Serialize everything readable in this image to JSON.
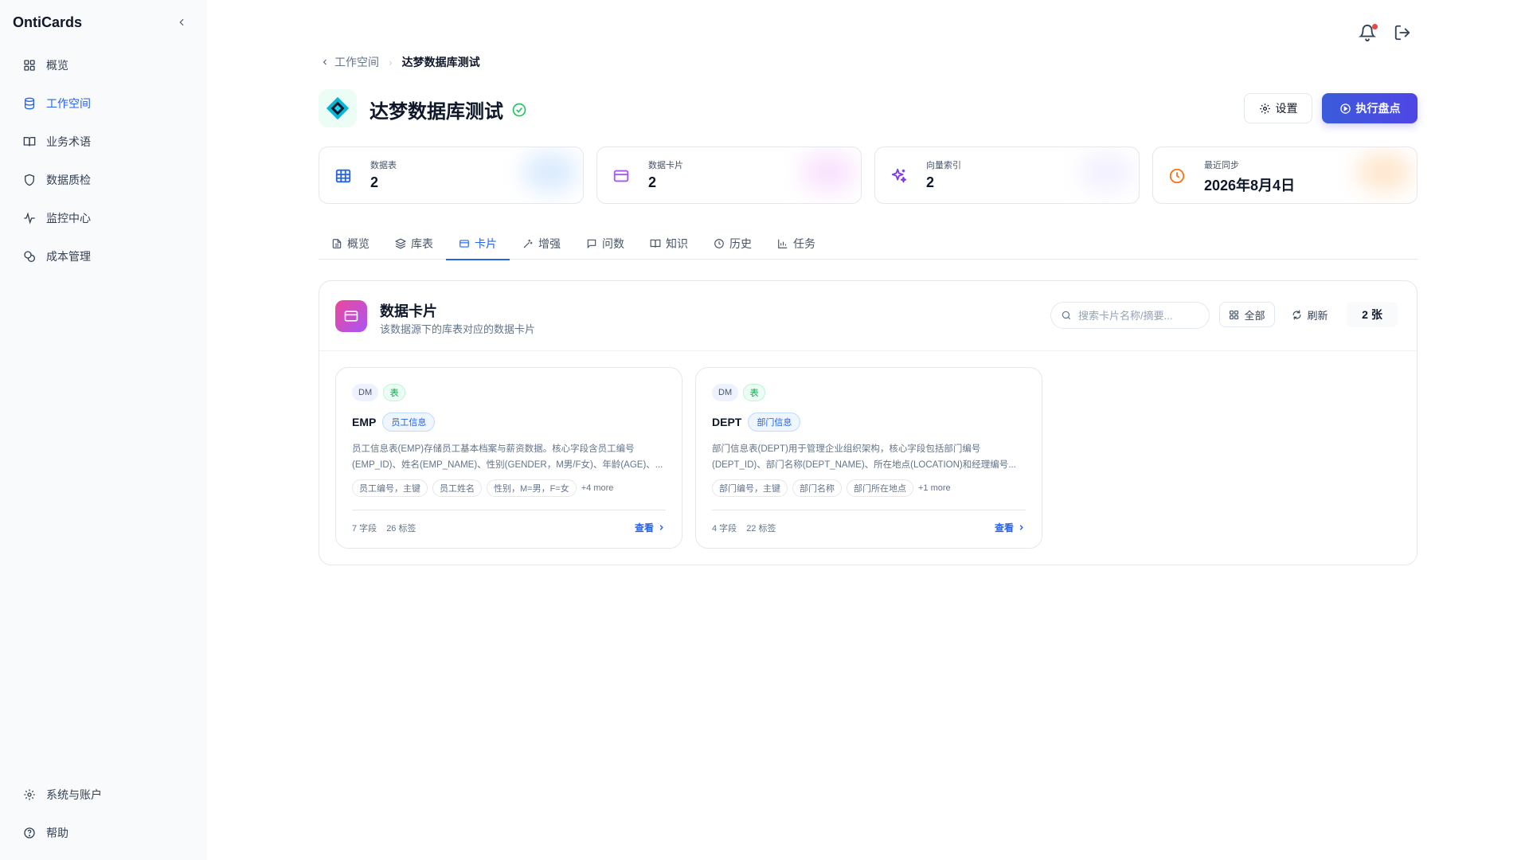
{
  "app": {
    "brand": "OntiCards"
  },
  "sidebar": {
    "items": [
      {
        "label": "概览",
        "icon": "grid-icon"
      },
      {
        "label": "工作空间",
        "icon": "database-icon"
      },
      {
        "label": "业务术语",
        "icon": "book-icon"
      },
      {
        "label": "数据质检",
        "icon": "shield-icon"
      },
      {
        "label": "监控中心",
        "icon": "activity-icon"
      },
      {
        "label": "成本管理",
        "icon": "coins-icon"
      }
    ],
    "bottom": [
      {
        "label": "系统与账户",
        "icon": "gear-icon"
      },
      {
        "label": "帮助",
        "icon": "help-icon"
      }
    ]
  },
  "breadcrumb": {
    "parent": "工作空间",
    "current": "达梦数据库测试"
  },
  "header": {
    "title": "达梦数据库测试",
    "settings_label": "设置",
    "run_label": "执行盘点"
  },
  "stats": [
    {
      "label": "数据表",
      "value": "2",
      "icon": "table-icon",
      "color": "#2563eb"
    },
    {
      "label": "数据卡片",
      "value": "2",
      "icon": "card-icon",
      "color": "#a855f7"
    },
    {
      "label": "向量索引",
      "value": "2",
      "icon": "sparkles-icon",
      "color": "#7c3aed"
    },
    {
      "label": "最近同步",
      "value": "2026年8月4日",
      "icon": "clock-icon",
      "color": "#f97316"
    }
  ],
  "tabs": [
    {
      "label": "概览",
      "icon": "file-icon"
    },
    {
      "label": "库表",
      "icon": "layers-icon"
    },
    {
      "label": "卡片",
      "icon": "card-icon"
    },
    {
      "label": "增强",
      "icon": "wand-icon"
    },
    {
      "label": "问数",
      "icon": "chat-icon"
    },
    {
      "label": "知识",
      "icon": "book-icon"
    },
    {
      "label": "历史",
      "icon": "history-icon"
    },
    {
      "label": "任务",
      "icon": "bar-chart-icon"
    }
  ],
  "panel": {
    "title": "数据卡片",
    "subtitle": "该数据源下的库表对应的数据卡片",
    "search_placeholder": "搜索卡片名称/摘要...",
    "filter_label": "全部",
    "refresh_label": "刷新",
    "count_label": "2 张"
  },
  "cards": [
    {
      "db": "DM",
      "type": "表",
      "name": "EMP",
      "category": "员工信息",
      "desc": "员工信息表(EMP)存储员工基本档案与薪资数据。核心字段含员工编号(EMP_ID)、姓名(EMP_NAME)、性别(GENDER，M男/F女)、年龄(AGE)、...",
      "tags": [
        "员工编号，主键",
        "员工姓名",
        "性别，M=男，F=女"
      ],
      "more": "+4 more",
      "fields": "7 字段",
      "labels": "26 标签",
      "view_label": "查看"
    },
    {
      "db": "DM",
      "type": "表",
      "name": "DEPT",
      "category": "部门信息",
      "desc": "部门信息表(DEPT)用于管理企业组织架构，核心字段包括部门编号(DEPT_ID)、部门名称(DEPT_NAME)、所在地点(LOCATION)和经理编号...",
      "tags": [
        "部门编号，主键",
        "部门名称",
        "部门所在地点"
      ],
      "more": "+1 more",
      "fields": "4 字段",
      "labels": "22 标签",
      "view_label": "查看"
    }
  ]
}
